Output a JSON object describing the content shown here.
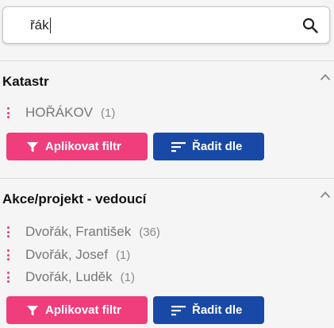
{
  "search": {
    "value": "řák",
    "icon": "search-icon"
  },
  "sections": [
    {
      "title": "Katastr",
      "items": [
        {
          "label": "HOŘÁKOV",
          "count": "(1)"
        }
      ],
      "apply_label": "Aplikovat filtr",
      "sort_label": "Řadit dle"
    },
    {
      "title": "Akce/projekt - vedoucí",
      "items": [
        {
          "label": "Dvořák, František",
          "count": "(36)"
        },
        {
          "label": "Dvořák, Josef",
          "count": "(1)"
        },
        {
          "label": "Dvořák, Luděk",
          "count": "(1)"
        }
      ],
      "apply_label": "Aplikovat filtr",
      "sort_label": "Řadit dle"
    }
  ],
  "colors": {
    "accent_pink": "#ef3e7b",
    "accent_blue": "#1949a6"
  }
}
